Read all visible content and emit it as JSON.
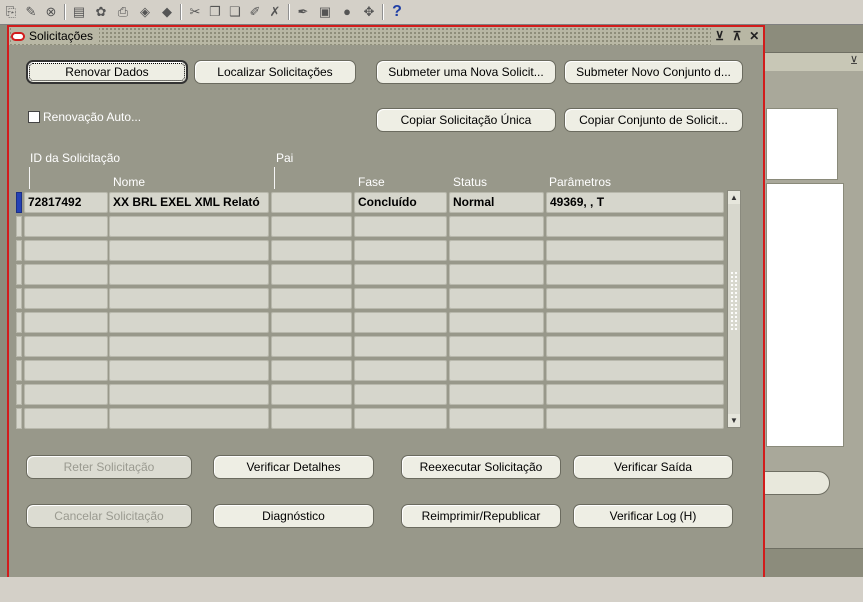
{
  "toolbar": {
    "icons": [
      "new-icon",
      "find-icon",
      "navigate-icon",
      "list-icon",
      "save-icon",
      "print-icon",
      "close-form-icon",
      "cut-icon",
      "copy-icon",
      "paste-icon",
      "edit-icon",
      "clear-icon",
      "attachments-icon",
      "folder-icon",
      "globe-icon",
      "tools-icon"
    ],
    "help_label": "?"
  },
  "window": {
    "title": "Solicitações",
    "ctrl_minimize": "⊻",
    "ctrl_maximize": "⊼",
    "ctrl_close": "✕"
  },
  "buttons": {
    "refresh": "Renovar Dados",
    "find": "Localizar Solicitações",
    "submit_new": "Submeter uma Nova Solicit...",
    "submit_set": "Submeter Novo Conjunto d...",
    "copy_single": "Copiar Solicitação Única",
    "copy_set": "Copiar Conjunto de Solicit...",
    "hold": "Reter Solicitação",
    "view_details": "Verificar Detalhes",
    "rerun": "Reexecutar Solicitação",
    "view_output": "Verificar Saída",
    "cancel": "Cancelar Solicitação",
    "diagnostics": "Diagnóstico",
    "reprint": "Reimprimir/Republicar",
    "view_log": "Verificar Log (H)"
  },
  "auto_refresh": {
    "label": "Renovação Auto...",
    "checked": false
  },
  "table": {
    "headers": {
      "request_id": "ID da Solicitação",
      "parent": "Pai",
      "name": "Nome",
      "phase": "Fase",
      "status": "Status",
      "parameters": "Parâmetros"
    },
    "rows": [
      {
        "request_id": "72817492",
        "name": "XX BRL EXEL XML Relató",
        "parent": "",
        "phase": "Concluído",
        "status": "Normal",
        "parameters": "49369, , T"
      },
      {
        "request_id": "",
        "name": "",
        "parent": "",
        "phase": "",
        "status": "",
        "parameters": ""
      },
      {
        "request_id": "",
        "name": "",
        "parent": "",
        "phase": "",
        "status": "",
        "parameters": ""
      },
      {
        "request_id": "",
        "name": "",
        "parent": "",
        "phase": "",
        "status": "",
        "parameters": ""
      },
      {
        "request_id": "",
        "name": "",
        "parent": "",
        "phase": "",
        "status": "",
        "parameters": ""
      },
      {
        "request_id": "",
        "name": "",
        "parent": "",
        "phase": "",
        "status": "",
        "parameters": ""
      },
      {
        "request_id": "",
        "name": "",
        "parent": "",
        "phase": "",
        "status": "",
        "parameters": ""
      },
      {
        "request_id": "",
        "name": "",
        "parent": "",
        "phase": "",
        "status": "",
        "parameters": ""
      },
      {
        "request_id": "",
        "name": "",
        "parent": "",
        "phase": "",
        "status": "",
        "parameters": ""
      },
      {
        "request_id": "",
        "name": "",
        "parent": "",
        "phase": "",
        "status": "",
        "parameters": ""
      }
    ]
  },
  "back_window": {
    "ctrl_minimize": "⊻"
  },
  "colors": {
    "window_bg": "#98988a",
    "window_border": "#d21c1c",
    "active_row_indicator": "#2441b5"
  }
}
